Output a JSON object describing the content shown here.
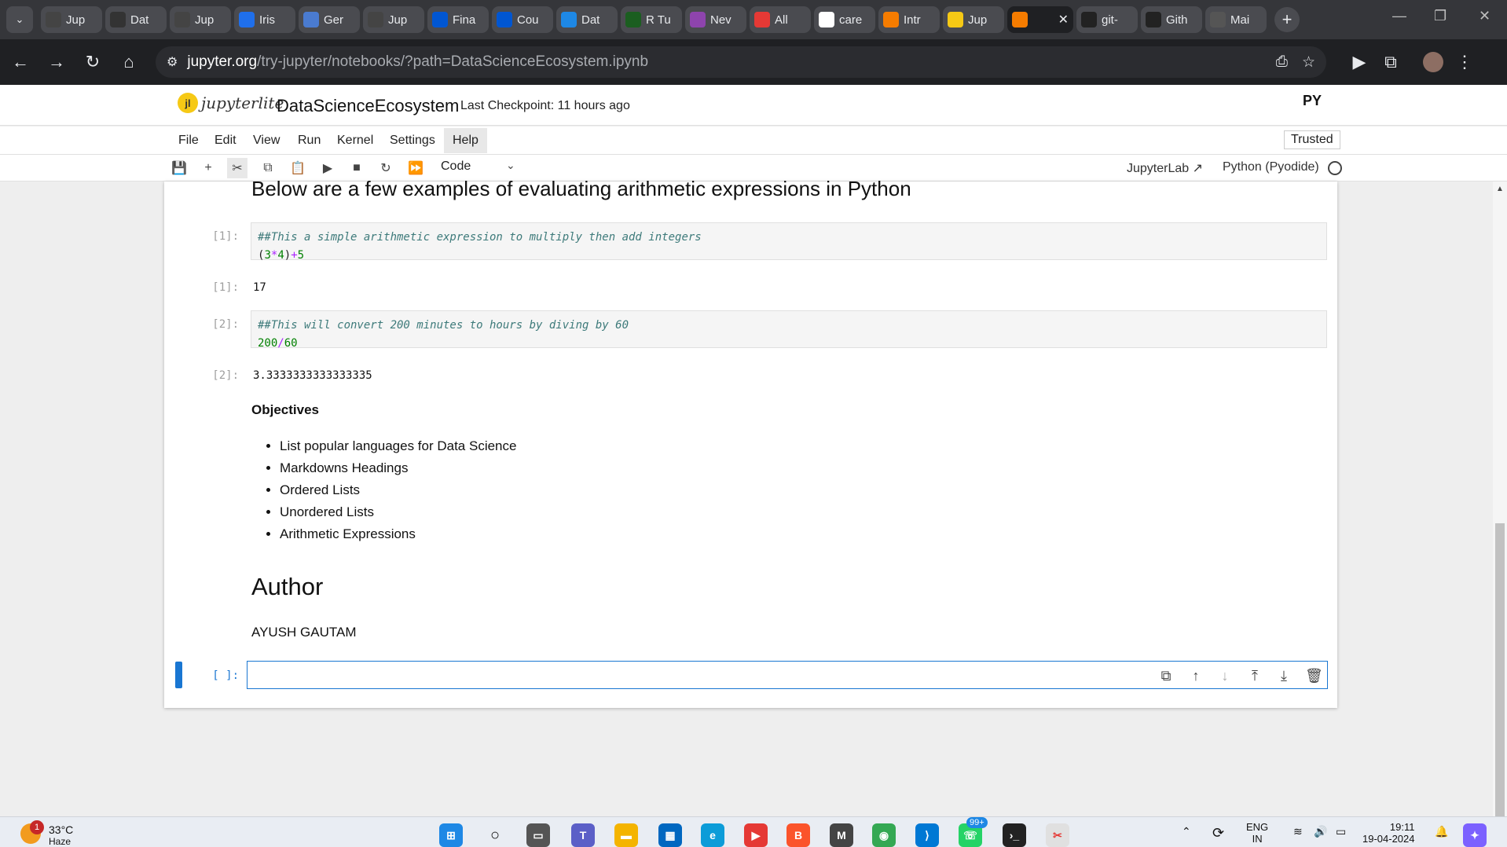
{
  "browser": {
    "tabs": [
      {
        "label": "Jup",
        "favicon": "notebook-icon",
        "color": "#444"
      },
      {
        "label": "Dat",
        "favicon": "tds-icon",
        "color": "#333"
      },
      {
        "label": "Jup",
        "favicon": "notebook-icon",
        "color": "#444"
      },
      {
        "label": "Iris",
        "favicon": "k-icon",
        "color": "#1f6feb"
      },
      {
        "label": "Ger",
        "favicon": "gemini-icon",
        "color": "#4a7bd0"
      },
      {
        "label": "Jup",
        "favicon": "notebook-icon",
        "color": "#444"
      },
      {
        "label": "Fina",
        "favicon": "coursera-icon",
        "color": "#0056d2"
      },
      {
        "label": "Cou",
        "favicon": "coursera-icon",
        "color": "#0056d2"
      },
      {
        "label": "Dat",
        "favicon": "is-icon",
        "color": "#1e88e5"
      },
      {
        "label": "R Tu",
        "favicon": "w-icon",
        "color": "#1b5e20"
      },
      {
        "label": "Nev",
        "favicon": "infinity-icon",
        "color": "#8e44ad"
      },
      {
        "label": "All",
        "favicon": "youtube-icon",
        "color": "#e53935"
      },
      {
        "label": "care",
        "favicon": "google-icon",
        "color": "#ffffff"
      },
      {
        "label": "Intr",
        "favicon": "book-icon",
        "color": "#f57c00"
      },
      {
        "label": "Jup",
        "favicon": "bulb-icon",
        "color": "#f6c915"
      },
      {
        "label": "",
        "favicon": "book-icon",
        "color": "#f57c00"
      },
      {
        "label": "git-",
        "favicon": "github-icon",
        "color": "#222"
      },
      {
        "label": "Gith",
        "favicon": "github-icon",
        "color": "#222"
      },
      {
        "label": "Mai",
        "favicon": "blob-icon",
        "color": "#555"
      }
    ],
    "url_host": "jupyter.org",
    "url_path": "/try-jupyter/notebooks/?path=DataScienceEcosystem.ipynb"
  },
  "jupyter": {
    "logo_text": "jupyterlite",
    "notebook_title": "DataScienceEcosystem",
    "checkpoint": "Last Checkpoint: 11 hours ago",
    "py_logo": "PY",
    "menus": [
      "File",
      "Edit",
      "View",
      "Run",
      "Kernel",
      "Settings",
      "Help"
    ],
    "trusted": "Trusted",
    "cell_type": "Code",
    "jupyterlab_link": "JupyterLab",
    "kernel_name": "Python (Pyodide)"
  },
  "cells": {
    "heading": "Below are a few examples of evaluating arithmetic expressions in Python",
    "cell1": {
      "prompt": "[1]:",
      "comment": "##This a simple arithmetic expression to multiply then add integers",
      "code_parts": [
        "(",
        "3",
        "*",
        "4",
        ")",
        "+",
        "5"
      ],
      "output": "17"
    },
    "cell2": {
      "prompt": "[2]:",
      "comment": "##This will convert 200 minutes to hours by diving by 60",
      "code_parts": [
        "200",
        "/",
        "60"
      ],
      "output": "3.3333333333333335"
    },
    "objectives_title": "Objectives",
    "objectives": [
      "List popular languages for Data Science",
      "Markdowns Headings",
      "Ordered Lists",
      "Unordered Lists",
      "Arithmetic Expressions"
    ],
    "author_heading": "Author",
    "author_name": "AYUSH GAUTAM",
    "empty_prompt": "[ ]:"
  },
  "taskbar": {
    "weather_temp": "33°C",
    "weather_desc": "Haze",
    "weather_badge": "1",
    "notification_badge": "99+",
    "language": "ENG",
    "region": "IN",
    "time": "19:11",
    "date": "19-04-2024"
  }
}
